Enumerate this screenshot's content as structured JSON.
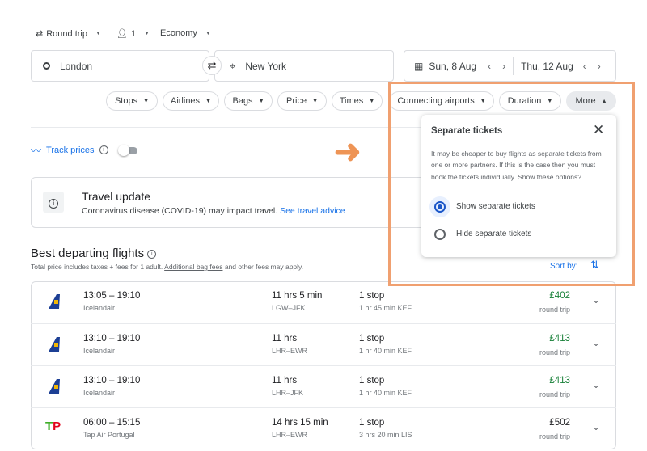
{
  "top_bar": {
    "trip_type": "Round trip",
    "passengers": "1",
    "cabin": "Economy"
  },
  "search": {
    "origin": "London",
    "destination": "New York",
    "depart_date": "Sun, 8 Aug",
    "return_date": "Thu, 12 Aug"
  },
  "filters": [
    "Stops",
    "Airlines",
    "Bags",
    "Price",
    "Times",
    "Connecting airports",
    "Duration",
    "More"
  ],
  "track_prices": {
    "label": "Track prices",
    "enabled": false
  },
  "travel_update": {
    "title": "Travel update",
    "text": "Coronavirus disease (COVID-19) may impact travel.",
    "link": "See travel advice"
  },
  "results": {
    "title": "Best departing flights",
    "subtitle_pre": "Total price includes taxes + fees for 1 adult.",
    "subtitle_link": "Additional bag fees",
    "subtitle_post": "and other fees may apply.",
    "sort_label": "Sort by:"
  },
  "popup": {
    "title": "Separate tickets",
    "body": "It may be cheaper to buy flights as separate tickets from one or more partners. If this is the case then you must book the tickets individually. Show these options?",
    "options": [
      "Show separate tickets",
      "Hide separate tickets"
    ],
    "selected": 0
  },
  "highlight_color": "#f0a070",
  "flights": [
    {
      "times": "13:05 – 19:10",
      "airline": "Icelandair",
      "duration": "11 hrs 5 min",
      "route": "LGW–JFK",
      "stops": "1 stop",
      "layover": "1 hr 45 min KEF",
      "price": "£402",
      "price_note": "round trip",
      "cheap": true
    },
    {
      "times": "13:10 – 19:10",
      "airline": "Icelandair",
      "duration": "11 hrs",
      "route": "LHR–EWR",
      "stops": "1 stop",
      "layover": "1 hr 40 min KEF",
      "price": "£413",
      "price_note": "round trip",
      "cheap": true
    },
    {
      "times": "13:10 – 19:10",
      "airline": "Icelandair",
      "duration": "11 hrs",
      "route": "LHR–JFK",
      "stops": "1 stop",
      "layover": "1 hr 40 min KEF",
      "price": "£413",
      "price_note": "round trip",
      "cheap": true
    },
    {
      "times": "06:00 – 15:15",
      "airline": "Tap Air Portugal",
      "duration": "14 hrs 15 min",
      "route": "LHR–EWR",
      "stops": "1 stop",
      "layover": "3 hrs 20 min LIS",
      "price": "£502",
      "price_note": "round trip",
      "cheap": false
    }
  ]
}
